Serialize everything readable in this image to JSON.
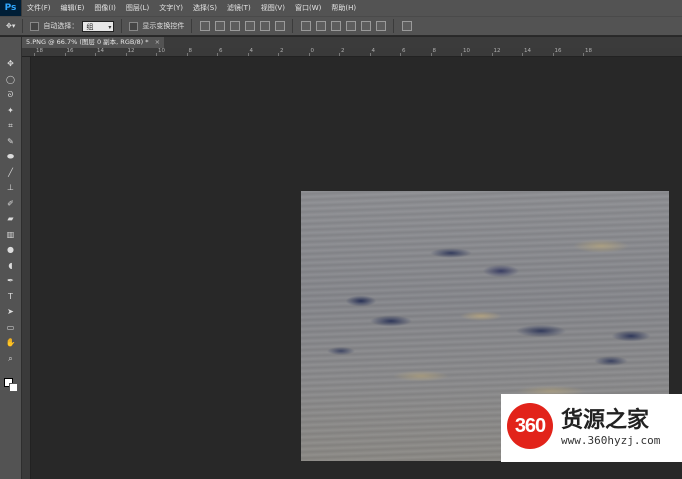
{
  "app": {
    "logo": "Ps"
  },
  "menu": [
    {
      "label": "文件(F)"
    },
    {
      "label": "编辑(E)"
    },
    {
      "label": "图像(I)"
    },
    {
      "label": "图层(L)"
    },
    {
      "label": "文字(Y)"
    },
    {
      "label": "选择(S)"
    },
    {
      "label": "滤镜(T)"
    },
    {
      "label": "视图(V)"
    },
    {
      "label": "窗口(W)"
    },
    {
      "label": "帮助(H)"
    }
  ],
  "options": {
    "auto_select_label": "自动选择：",
    "auto_select_value": "组",
    "show_transform_label": "显示变换控件"
  },
  "document": {
    "tab_title": "5.PNG @ 66.7% (图层 0 副本, RGB/8) *",
    "close_glyph": "×"
  },
  "ruler": {
    "top_labels": [
      "18",
      "16",
      "14",
      "12",
      "10",
      "8",
      "6",
      "4",
      "2",
      "0",
      "2",
      "4",
      "6",
      "8",
      "10",
      "12",
      "14",
      "16",
      "18"
    ]
  },
  "tools": [
    {
      "icon": "move-icon",
      "glyph": "✥"
    },
    {
      "icon": "marquee-icon",
      "glyph": "◯"
    },
    {
      "icon": "lasso-icon",
      "glyph": "ᘐ"
    },
    {
      "icon": "magic-wand-icon",
      "glyph": "✦"
    },
    {
      "icon": "crop-icon",
      "glyph": "⌗"
    },
    {
      "icon": "eyedropper-icon",
      "glyph": "✎"
    },
    {
      "icon": "healing-icon",
      "glyph": "⬬"
    },
    {
      "icon": "brush-icon",
      "glyph": "╱"
    },
    {
      "icon": "stamp-icon",
      "glyph": "⊥"
    },
    {
      "icon": "history-brush-icon",
      "glyph": "✐"
    },
    {
      "icon": "eraser-icon",
      "glyph": "▰"
    },
    {
      "icon": "gradient-icon",
      "glyph": "▥"
    },
    {
      "icon": "blur-icon",
      "glyph": "●"
    },
    {
      "icon": "dodge-icon",
      "glyph": "◖"
    },
    {
      "icon": "pen-icon",
      "glyph": "✒"
    },
    {
      "icon": "type-icon",
      "glyph": "T"
    },
    {
      "icon": "path-select-icon",
      "glyph": "➤"
    },
    {
      "icon": "shape-icon",
      "glyph": "▭"
    },
    {
      "icon": "hand-icon",
      "glyph": "✋"
    },
    {
      "icon": "zoom-icon",
      "glyph": "⌕"
    }
  ],
  "watermark": {
    "badge": "360",
    "title": "货源之家",
    "url": "www.360hyzj.com"
  },
  "colors": {
    "foreground": "#ffffff",
    "background": "#ffffff",
    "badge_red": "#e2231a"
  }
}
